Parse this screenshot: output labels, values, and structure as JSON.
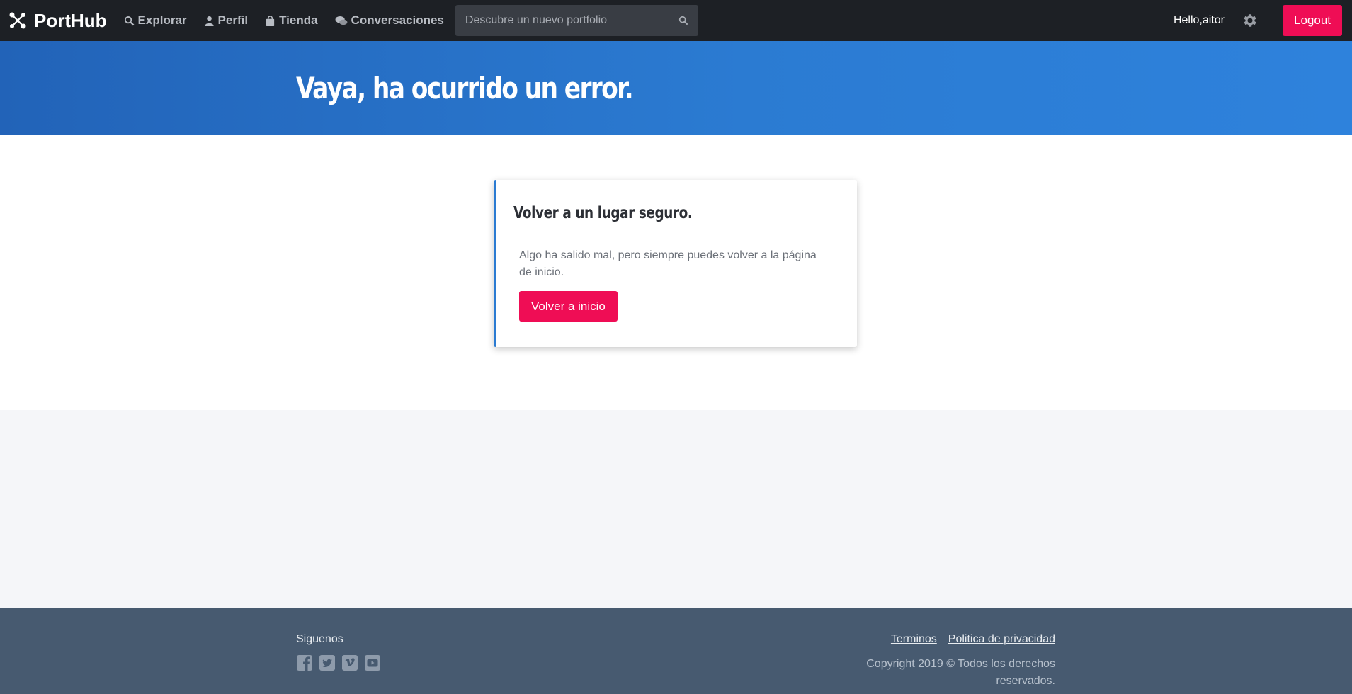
{
  "navbar": {
    "brand": "PortHub",
    "items": [
      {
        "label": "Explorar",
        "icon": "search-icon"
      },
      {
        "label": "Perfil",
        "icon": "user-icon"
      },
      {
        "label": "Tienda",
        "icon": "shopping-bag-icon"
      },
      {
        "label": "Conversaciones",
        "icon": "comments-icon"
      }
    ],
    "search_placeholder": "Descubre un nuevo portfolio",
    "greeting": "Hello,aitor",
    "logout_label": "Logout"
  },
  "hero": {
    "title": "Vaya, ha ocurrido un error."
  },
  "card": {
    "title": "Volver a un lugar seguro.",
    "message": "Algo ha salido mal, pero siempre puedes volver a la página de inicio.",
    "button_label": "Volver a inicio"
  },
  "footer": {
    "follow_label": "Siguenos",
    "socials": [
      "facebook-icon",
      "twitter-icon",
      "vimeo-icon",
      "youtube-icon"
    ],
    "links": [
      "Terminos",
      "Politica de privacidad"
    ],
    "copyright": "Copyright 2019 © Todos los derechos reservados."
  },
  "colors": {
    "navbar_bg": "#1d2025",
    "accent": "#ef0d55",
    "hero_blue": "#2b7bd2",
    "footer_bg": "#475a70"
  }
}
